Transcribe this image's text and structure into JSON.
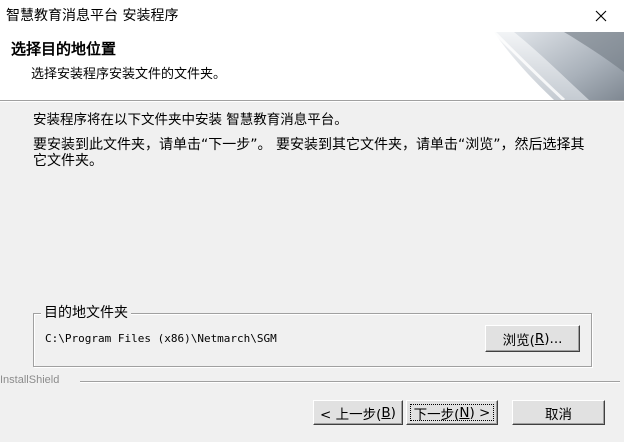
{
  "window": {
    "title": "智慧教育消息平台 安装程序"
  },
  "header": {
    "title": "选择目的地位置",
    "subtitle": "选择安装程序安装文件的文件夹。"
  },
  "content": {
    "line1": "安装程序将在以下文件夹中安装 智慧教育消息平台。",
    "line2": "要安装到此文件夹，请单击“下一步”。 要安装到其它文件夹，请单击“浏览”，然后选择其它文件夹。"
  },
  "destination": {
    "group_label": "目的地文件夹",
    "path": "C:\\Program Files (x86)\\Netmarch\\SGM",
    "browse_label_prefix": "浏览(",
    "browse_hotkey": "R",
    "browse_label_suffix": ")..."
  },
  "footer": {
    "brand": "InstallShield",
    "back_prefix": "< 上一步(",
    "back_hotkey": "B",
    "back_suffix": ")",
    "next_prefix": "下一步(",
    "next_hotkey": "N",
    "next_suffix": ") >",
    "cancel_label": "取消"
  },
  "icons": {
    "close": "close-icon",
    "header_graphic": "installer-banner-graphic"
  },
  "colors": {
    "dialog_bg": "#f0f0f0",
    "header_bg": "#ffffff",
    "button_bg": "#e1e1e1"
  }
}
